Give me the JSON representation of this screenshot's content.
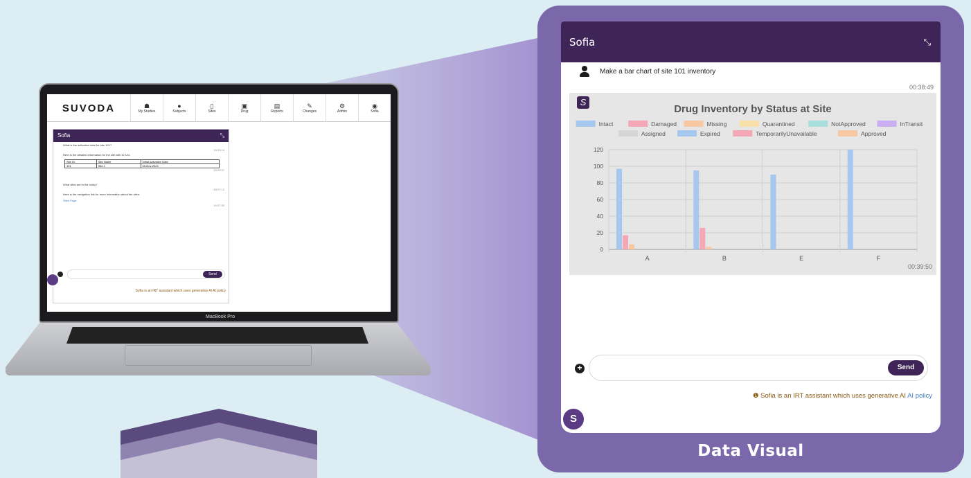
{
  "laptop": {
    "brand": "MacBook Pro",
    "app_logo": "SUVODA",
    "nav": [
      {
        "label": "My Studies",
        "icon": "org-chart-icon"
      },
      {
        "label": "Subjects",
        "icon": "person-icon"
      },
      {
        "label": "Sites",
        "icon": "building-icon"
      },
      {
        "label": "Drug",
        "icon": "briefcase-icon"
      },
      {
        "label": "Reports",
        "icon": "chart-icon"
      },
      {
        "label": "Changes",
        "icon": "edit-icon"
      },
      {
        "label": "Admin",
        "icon": "gears-icon"
      },
      {
        "label": "Sofia",
        "icon": "sofia-icon"
      }
    ],
    "chat": {
      "title": "Sofia",
      "q1": "What is the activation date for site 101?",
      "t1": "19:23:14",
      "a1": "Here is the detailed information for the site with ID 101:",
      "table_headers": [
        "Site ID",
        "Site Name",
        "Initial Activation Date"
      ],
      "table_row": [
        "101",
        "Site 1",
        "05-Nov-2024"
      ],
      "t2": "19:23:37",
      "q2": "What sites are in the study?",
      "t3": "19:27:12",
      "a2": "Here is the navigation link for more information about the sites:",
      "a2_link": "Sites Page",
      "t4": "19:27:30",
      "send": "Send",
      "footer": "Sofia is an IRT assistant which uses generative AI AI policy"
    }
  },
  "card": {
    "caption": "Data Visual",
    "title": "Sofia",
    "user_message": "Make a bar chart of site 101 inventory",
    "user_time": "00:38:49",
    "bot_time": "00:39:50",
    "send_label": "Send",
    "disclaimer_text": "Sofia is an IRT assistant which uses generative AI",
    "disclaimer_link": "AI policy"
  },
  "chart_data": {
    "type": "bar",
    "title": "Drug Inventory by Status at Site",
    "categories": [
      "A",
      "B",
      "E",
      "F"
    ],
    "ylim": [
      0,
      120
    ],
    "yticks": [
      0,
      20,
      40,
      60,
      80,
      100,
      120
    ],
    "legend_position": "top",
    "series": [
      {
        "name": "Intact",
        "color": "#a6c8ee",
        "values": [
          97,
          95,
          90,
          120
        ]
      },
      {
        "name": "Damaged",
        "color": "#f4a7b5",
        "values": [
          17,
          26,
          0,
          0
        ]
      },
      {
        "name": "Missing",
        "color": "#f7c8a2",
        "values": [
          6,
          3,
          0,
          0
        ]
      },
      {
        "name": "Quarantined",
        "color": "#f9e0a8",
        "values": [
          0,
          0,
          0,
          0
        ]
      },
      {
        "name": "NotApproved",
        "color": "#a8dedc",
        "values": [
          0,
          0,
          0,
          0
        ]
      },
      {
        "name": "InTransit",
        "color": "#c9aef2",
        "values": [
          0,
          0,
          0,
          0
        ]
      },
      {
        "name": "Assigned",
        "color": "#d6d6d6",
        "values": [
          0,
          0,
          0,
          0
        ]
      },
      {
        "name": "Expired",
        "color": "#a6c8ee",
        "values": [
          0,
          0,
          0,
          0
        ]
      },
      {
        "name": "TemporarilyUnavailable",
        "color": "#f4a7b5",
        "values": [
          0,
          0,
          0,
          0
        ]
      },
      {
        "name": "Approved",
        "color": "#f7c8a2",
        "values": [
          0,
          0,
          0,
          0
        ]
      }
    ]
  }
}
